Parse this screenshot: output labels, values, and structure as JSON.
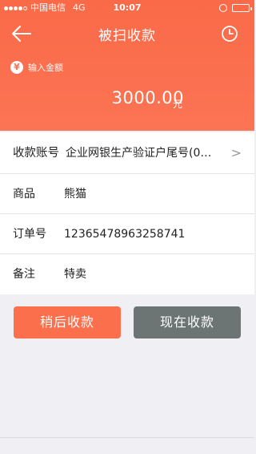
{
  "status_bar": {
    "carrier": "中国电信",
    "network": "4G",
    "time": "10:07"
  },
  "nav": {
    "title": "被扫收款",
    "back_icon": "arrow-left-icon",
    "history_icon": "clock-icon"
  },
  "amount": {
    "label": "输入金额",
    "badge_symbol": "¥",
    "value": "3000.00",
    "currency": "元"
  },
  "form": {
    "account": {
      "label": "收款账号",
      "value": "企业网银生产验证户尾号(0…",
      "chevron": ">"
    },
    "product": {
      "label": "商品",
      "value": "熊猫"
    },
    "order": {
      "label": "订单号",
      "value": "12365478963258741"
    },
    "note": {
      "label": "备注",
      "value": "特卖"
    }
  },
  "actions": {
    "later_label": "稍后收款",
    "now_label": "现在收款"
  },
  "colors": {
    "header": "#fb7454",
    "later_button": "#fb6f4c",
    "now_button": "#6c7573",
    "background": "#efeff4"
  }
}
